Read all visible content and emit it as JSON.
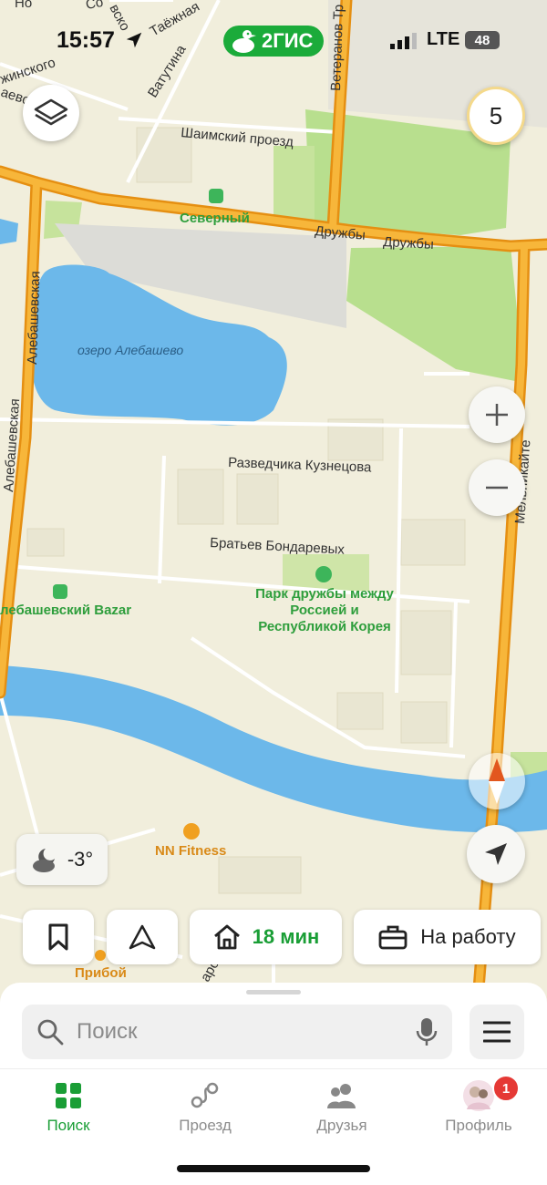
{
  "status_bar": {
    "time": "15:57",
    "carrier": "LTE",
    "battery": "48"
  },
  "brand": {
    "name": "2ГИС"
  },
  "map": {
    "layers_button": "layers",
    "count_badge": "5",
    "streets": {
      "top_left_1": "Со",
      "top_left_2": "вско",
      "taezhnaya": "Таёжная",
      "zhinskogo": "жинского",
      "aevo": "аево",
      "vatutina": "Ватутина",
      "veteranov": "Ветеранов Тр",
      "shaimsky": "Шаимский проезд",
      "druzhby_1": "Дружбы",
      "druzhby_2": "Дружбы",
      "alebashevskaya_1": "Алебашевская",
      "alebashevskaya_2": "Алебашевская",
      "razvedchika": "Разведчика Кузнецова",
      "bondarevykh": "Братьев Бондаревых",
      "melnikayte": "Мельникайте",
      "no": "Но"
    },
    "places": {
      "severny": "Северный",
      "lake": "озеро Алебашево",
      "bazar": "лебашевский Bazar",
      "park_line1": "Парк дружбы между",
      "park_line2": "Россией и",
      "park_line3": "Республикой Корея",
      "fitness": "NN Fitness",
      "pribоy": "Прибой",
      "bottom_street": "аро"
    }
  },
  "weather": {
    "temp": "-3°",
    "icon": "moon-cloud-icon"
  },
  "quick_chips": {
    "home_time": "18 мин",
    "work_label": "На работу"
  },
  "search": {
    "placeholder": "Поиск"
  },
  "tabs": [
    {
      "label": "Поиск",
      "icon": "grid-icon",
      "active": true
    },
    {
      "label": "Проезд",
      "icon": "route-icon",
      "active": false
    },
    {
      "label": "Друзья",
      "icon": "friends-icon",
      "active": false
    },
    {
      "label": "Профиль",
      "icon": "avatar",
      "active": false,
      "badge": "1"
    }
  ],
  "colors": {
    "accent": "#1a9e36",
    "road": "#f3a01c",
    "water": "#6cb8ea",
    "park": "#b8df8e",
    "map_bg": "#f1eedc"
  }
}
